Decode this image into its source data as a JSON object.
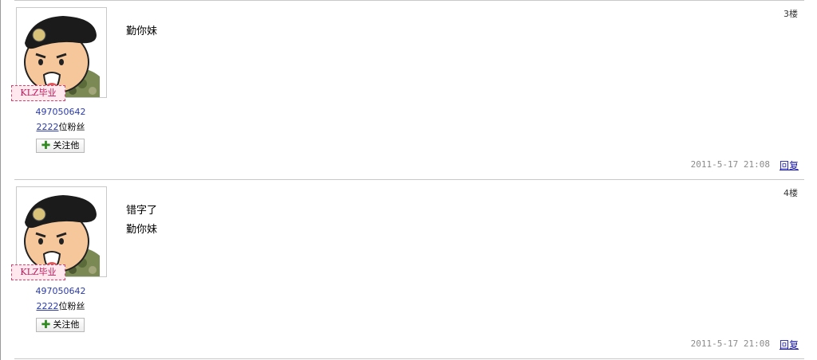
{
  "posts": [
    {
      "floor": "3楼",
      "badge": "KLZ毕业",
      "uid": "497050642",
      "fans_count": "2222",
      "fans_suffix": "位粉丝",
      "follow_label": "关注他",
      "content_lines": [
        "勤你妹"
      ],
      "time": "2011-5-17 21:08",
      "reply_label": "回复"
    },
    {
      "floor": "4楼",
      "badge": "KLZ毕业",
      "uid": "497050642",
      "fans_count": "2222",
      "fans_suffix": "位粉丝",
      "follow_label": "关注他",
      "content_lines": [
        "错字了",
        "勤你妹"
      ],
      "time": "2011-5-17 21:08",
      "reply_label": "回复"
    }
  ],
  "colors": {
    "link": "#2a3aa8",
    "badge_border": "#d9426e",
    "timestamp": "#8a8a8a"
  },
  "icons": [
    "avatar-soldier",
    "plus-icon"
  ]
}
